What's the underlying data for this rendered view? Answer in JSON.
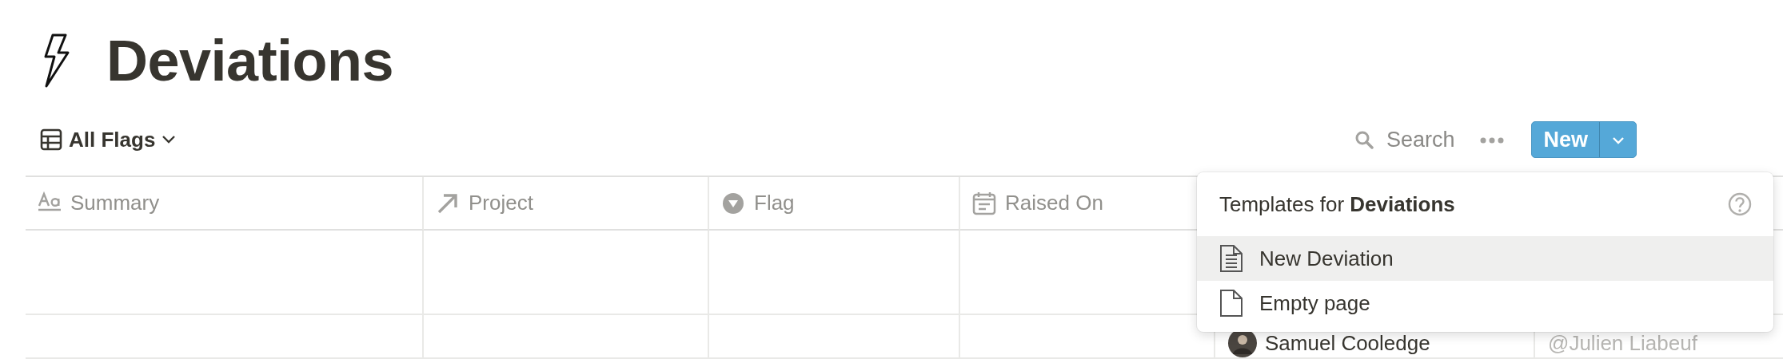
{
  "page": {
    "title": "Deviations"
  },
  "view": {
    "label": "All Flags"
  },
  "toolbar": {
    "search_label": "Search",
    "new_button": "New"
  },
  "table": {
    "columns": [
      {
        "label": "Summary",
        "kind": "text"
      },
      {
        "label": "Project",
        "kind": "relation"
      },
      {
        "label": "Flag",
        "kind": "select"
      },
      {
        "label": "Raised On",
        "kind": "date"
      }
    ],
    "rows": [
      {
        "kind": "blank"
      },
      {
        "kind": "filled",
        "person": "Samuel Cooledge",
        "mention": "@Julien Liabeuf"
      }
    ]
  },
  "templates_menu": {
    "title": "Templates for **Deviations**",
    "items": [
      {
        "label": "New Deviation",
        "kind": "template",
        "selected": true
      },
      {
        "label": "Empty page",
        "kind": "empty",
        "selected": false
      }
    ]
  }
}
